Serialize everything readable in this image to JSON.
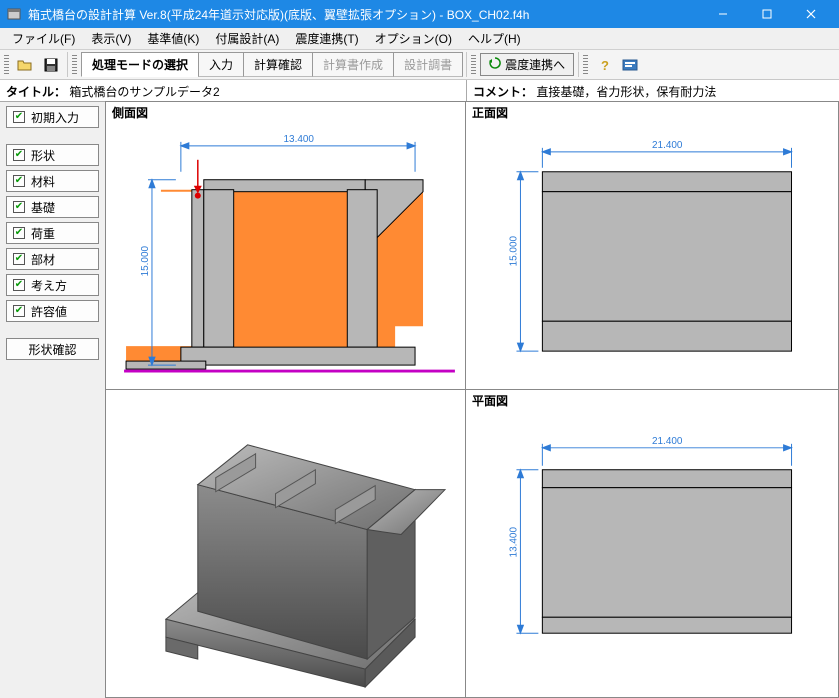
{
  "window": {
    "title": "箱式橋台の設計計算 Ver.8(平成24年道示対応版)(底版、翼壁拡張オプション) - BOX_CH02.f4h"
  },
  "menu": {
    "file": "ファイル(F)",
    "view": "表示(V)",
    "basis": "基準値(K)",
    "attach": "付属設計(A)",
    "seismic": "震度連携(T)",
    "option": "オプション(O)",
    "help": "ヘルプ(H)"
  },
  "tabs": {
    "mode": "処理モードの選択",
    "input": "入力",
    "calc": "計算確認",
    "report": "計算書作成",
    "design": "設計調書"
  },
  "buttons": {
    "seismic_to": "震度連携へ"
  },
  "info": {
    "title_label": "タイトル：",
    "title_value": "箱式橋台のサンプルデータ2",
    "comment_label": "コメント：",
    "comment_value": "直接基礎，省力形状，保有耐力法"
  },
  "sidebar": {
    "initial": "初期入力",
    "shape": "形状",
    "material": "材料",
    "found": "基礎",
    "load": "荷重",
    "member": "部材",
    "assume": "考え方",
    "allow": "許容値",
    "confirm": "形状確認"
  },
  "views": {
    "side": "側面図",
    "front": "正面図",
    "plan": "平面図"
  },
  "dims": {
    "side_w": "13.400",
    "side_h": "15.000",
    "front_w": "21.400",
    "front_h": "15.000",
    "plan_w": "21.400",
    "plan_h": "13.400"
  }
}
